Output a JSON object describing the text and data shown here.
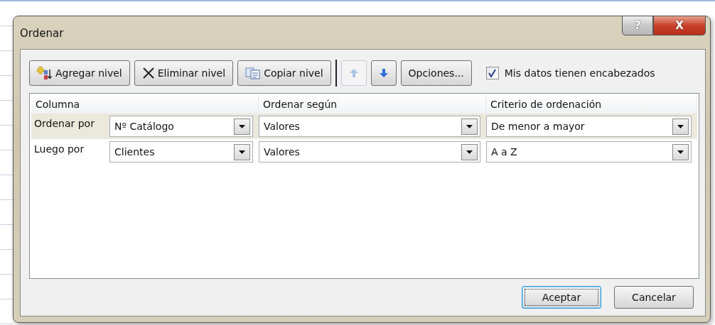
{
  "window": {
    "title": "Ordenar"
  },
  "title_buttons": [
    {
      "kind": "help",
      "label": "?"
    },
    {
      "kind": "close",
      "label": "X"
    }
  ],
  "toolbar": [
    {
      "kind": "add",
      "label": "Agregar nivel",
      "disabled": false
    },
    {
      "kind": "delete",
      "label": "Eliminar nivel",
      "disabled": false
    },
    {
      "kind": "copy",
      "label": "Copiar nivel",
      "disabled": false
    },
    {
      "kind": "up",
      "disabled": true
    },
    {
      "kind": "down",
      "disabled": false
    },
    {
      "kind": "text",
      "label": "Opciones...",
      "disabled": false
    }
  ],
  "headers_checkbox": {
    "label": "Mis datos tienen encabezados",
    "checked": true
  },
  "table": {
    "columns": [
      "Columna",
      "Ordenar según",
      "Criterio de ordenación"
    ],
    "rows": [
      {
        "label": "Ordenar por",
        "column": "Nº Catálogo",
        "sort_on": "Valores",
        "order": "De menor a mayor",
        "selected": true
      },
      {
        "label": "Luego por",
        "column": "Clientes",
        "sort_on": "Valores",
        "order": "A a Z",
        "selected": false
      }
    ]
  },
  "buttons": [
    {
      "label": "Aceptar",
      "default": true
    },
    {
      "label": "Cancelar",
      "default": false
    }
  ]
}
